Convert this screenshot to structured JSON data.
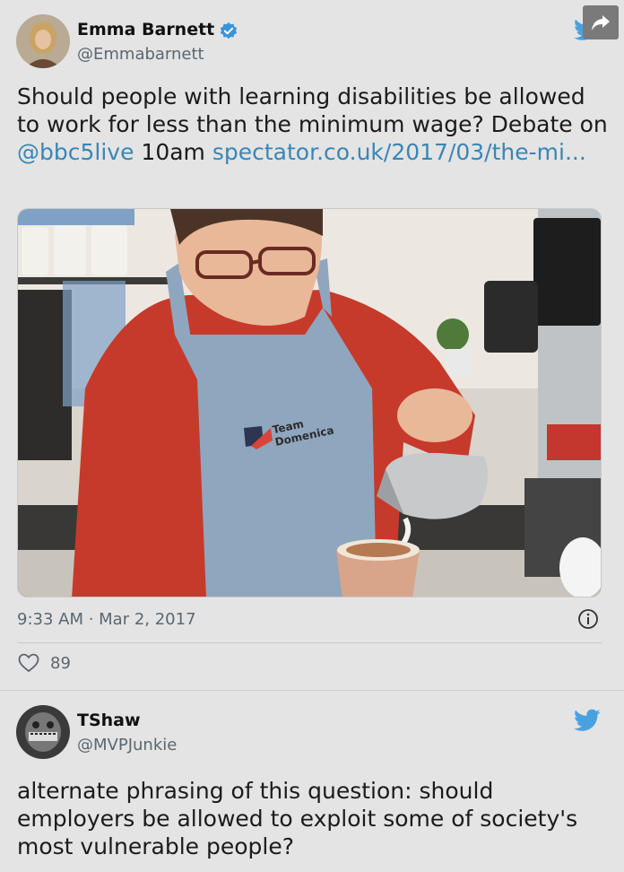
{
  "tweet1": {
    "author_name": "Emma Barnett",
    "author_handle": "@Emmabarnett",
    "text_before_mention": "Should people with learning disabilities be allowed to work for less than the minimum wage? Debate on ",
    "mention": "@bbc5live",
    "text_after_mention": " 10am ",
    "link": "spectator.co.uk/2017/03/the-mi...",
    "timestamp": "9:33 AM · Mar 2, 2017",
    "likes": "89",
    "apron_text_line1": "Team",
    "apron_text_line2": "Domenica"
  },
  "tweet2": {
    "author_name": "TShaw",
    "author_handle": "@MVPJunkie",
    "text": "alternate phrasing of this question: should employers be allowed to exploit some of society's most vulnerable people?"
  },
  "colors": {
    "background": "#e4e4e4",
    "link": "#3a86b5",
    "verified": "#3a93d6",
    "twitter_bird": "#4aa1e0"
  },
  "icons": [
    "verified-badge-icon",
    "twitter-bird-icon",
    "share-icon",
    "info-icon",
    "heart-icon"
  ]
}
